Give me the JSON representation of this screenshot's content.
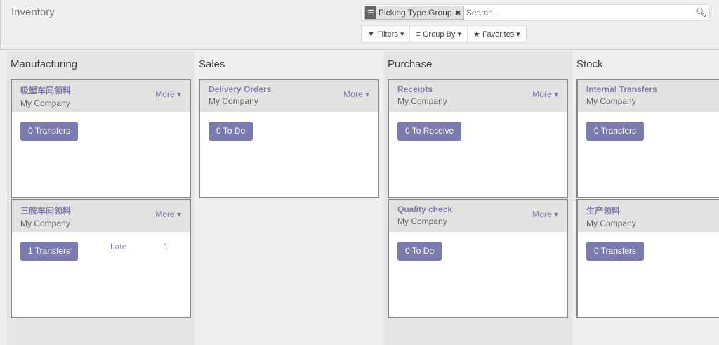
{
  "app_title": "Inventory",
  "search": {
    "facet_label": "Picking Type Group",
    "placeholder": "Search..."
  },
  "filters": {
    "filters": "Filters",
    "group_by": "Group By",
    "favorites": "Favorites"
  },
  "columns": [
    {
      "title": "Manufacturing",
      "cards": [
        {
          "name": "吸塑车间领料",
          "company": "My Company",
          "more": "More",
          "button": "0 Transfers"
        },
        {
          "name": "三胺车间领料",
          "company": "My Company",
          "more": "More",
          "button": "1 Transfers",
          "late_label": "Late",
          "late_count": "1"
        }
      ]
    },
    {
      "title": "Sales",
      "cards": [
        {
          "name": "Delivery Orders",
          "company": "My Company",
          "more": "More",
          "button": "0 To Do"
        }
      ]
    },
    {
      "title": "Purchase",
      "cards": [
        {
          "name": "Receipts",
          "company": "My Company",
          "more": "More",
          "button": "0 To Receive"
        },
        {
          "name": "Quality check",
          "company": "My Company",
          "more": "More",
          "button": "0 To Do"
        }
      ]
    },
    {
      "title": "Stock",
      "cards": [
        {
          "name": "Internal Transfers",
          "company": "My Company",
          "button": "0 Transfers"
        },
        {
          "name": "生产领料",
          "company": "My Company",
          "button": "0 Transfers"
        }
      ]
    }
  ],
  "colors": {
    "accent": "#7c7bad"
  }
}
